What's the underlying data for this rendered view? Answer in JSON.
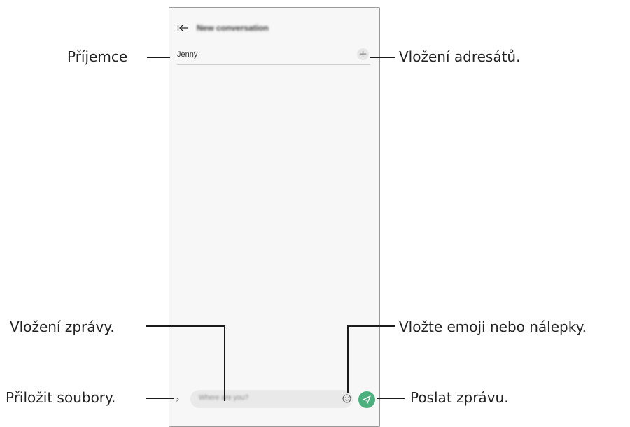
{
  "phone": {
    "title": "New conversation",
    "recipient": "Jenny",
    "add_button": "+",
    "input_placeholder": "Where are you?",
    "attach_icon": "›"
  },
  "annotations": {
    "recipient": "Příjemce",
    "add_recipients": "Vložení adresátů.",
    "enter_message": "Vložení zprávy.",
    "emoji": "Vložte emoji nebo nálepky.",
    "attach": "Přiložit soubory.",
    "send": "Poslat zprávu."
  },
  "colors": {
    "send_accent": "#4caf7e"
  },
  "icons": [
    "back-icon",
    "add-icon",
    "attach-icon",
    "emoji-icon",
    "send-icon"
  ]
}
